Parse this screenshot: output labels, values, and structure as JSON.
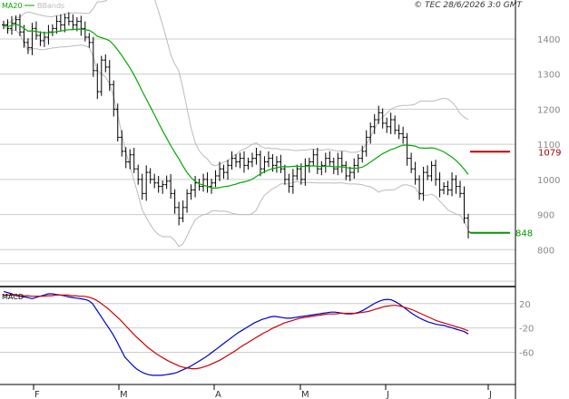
{
  "copyright": "© TEC 28/6/2026 3:0 GMT",
  "colors": {
    "ma": "#00aa00",
    "bbands": "#bbbbbb",
    "bars": "#000000",
    "macd": "#0000cc",
    "signal": "#cc0000",
    "resistance": "#cc0000",
    "support": "#009900",
    "grid": "#cccccc",
    "frame": "#000000"
  },
  "chart_data": [
    {
      "type": "ohlc",
      "legend": [
        {
          "label": "MA20",
          "color": "#00aa00"
        },
        {
          "label": "BBands",
          "color": "#bbbbbb"
        }
      ],
      "y_ticks": [
        800,
        900,
        1000,
        1100,
        1200,
        1300,
        1400
      ],
      "ylim": [
        700,
        1480
      ],
      "x_labels": [
        "F",
        "M",
        "A",
        "M",
        "J",
        "J"
      ],
      "levels": {
        "resistance": 1079,
        "support": 848
      },
      "level_labels": {
        "resistance": "1079",
        "support": "848"
      },
      "grid": true,
      "close": [
        1440,
        1430,
        1445,
        1455,
        1420,
        1390,
        1375,
        1430,
        1410,
        1395,
        1405,
        1420,
        1430,
        1450,
        1440,
        1460,
        1450,
        1440,
        1450,
        1430,
        1405,
        1390,
        1310,
        1250,
        1340,
        1320,
        1270,
        1200,
        1120,
        1080,
        1050,
        1070,
        1030,
        1000,
        960,
        1020,
        1000,
        990,
        980,
        985,
        995,
        960,
        920,
        890,
        920,
        960,
        970,
        990,
        980,
        1000,
        980,
        990,
        1010,
        1030,
        1020,
        1040,
        1060,
        1050,
        1060,
        1040,
        1050,
        1060,
        1070,
        1030,
        1050,
        1060,
        1040,
        1050,
        1030,
        1000,
        980,
        1010,
        1030,
        1000,
        1040,
        1050,
        1070,
        1030,
        1040,
        1060,
        1050,
        1030,
        1060,
        1040,
        1010,
        1020,
        1040,
        1060,
        1080,
        1120,
        1150,
        1170,
        1190,
        1160,
        1150,
        1170,
        1140,
        1130,
        1120,
        1060,
        1030,
        1000,
        960,
        1020,
        1010,
        1040,
        1000,
        970,
        980,
        970,
        1000,
        980,
        960,
        890,
        850
      ]
    },
    {
      "type": "line",
      "title": "MACD",
      "y_ticks": [
        20,
        -20,
        -60
      ],
      "y_tick_labels": [
        "20",
        "-20",
        "-60"
      ],
      "ylim": [
        -110,
        45
      ],
      "series": [
        {
          "color": "#0000cc",
          "values": [
            40,
            38,
            36,
            33,
            32,
            31,
            30,
            28,
            30,
            32,
            34,
            36,
            36,
            35,
            34,
            33,
            31,
            30,
            29,
            28,
            27,
            25,
            20,
            10,
            0,
            -10,
            -20,
            -30,
            -42,
            -55,
            -68,
            -75,
            -82,
            -88,
            -92,
            -95,
            -97,
            -98,
            -98,
            -98,
            -97,
            -96,
            -95,
            -93,
            -90,
            -87,
            -84,
            -80,
            -76,
            -72,
            -68,
            -63,
            -58,
            -53,
            -48,
            -43,
            -38,
            -33,
            -28,
            -24,
            -20,
            -16,
            -12,
            -9,
            -6,
            -4,
            -2,
            -1,
            -2,
            -3,
            -4,
            -4,
            -3,
            -2,
            -1,
            0,
            1,
            2,
            3,
            4,
            5,
            6,
            6,
            5,
            4,
            3,
            3,
            4,
            6,
            9,
            13,
            17,
            21,
            24,
            26,
            27,
            26,
            23,
            19,
            14,
            9,
            4,
            0,
            -4,
            -7,
            -10,
            -12,
            -14,
            -15,
            -16,
            -18,
            -20,
            -22,
            -24,
            -26,
            -30
          ]
        },
        {
          "color": "#cc0000",
          "values": [
            34,
            34,
            34,
            34,
            33,
            33,
            33,
            32,
            32,
            32,
            32,
            33,
            33,
            34,
            34,
            34,
            34,
            33,
            33,
            32,
            32,
            31,
            29,
            26,
            22,
            17,
            12,
            6,
            0,
            -6,
            -13,
            -20,
            -27,
            -34,
            -40,
            -46,
            -52,
            -57,
            -62,
            -66,
            -70,
            -74,
            -77,
            -80,
            -83,
            -85,
            -86,
            -87,
            -87,
            -86,
            -84,
            -82,
            -79,
            -76,
            -73,
            -69,
            -65,
            -61,
            -57,
            -52,
            -48,
            -44,
            -40,
            -36,
            -32,
            -28,
            -25,
            -21,
            -18,
            -15,
            -12,
            -10,
            -8,
            -6,
            -4,
            -3,
            -2,
            -1,
            0,
            1,
            2,
            3,
            3,
            3,
            4,
            4,
            4,
            4,
            4,
            5,
            6,
            7,
            9,
            11,
            13,
            15,
            16,
            17,
            17,
            16,
            14,
            12,
            10,
            7,
            4,
            1,
            -2,
            -5,
            -8,
            -10,
            -12,
            -14,
            -16,
            -18,
            -20,
            -22,
            -25
          ]
        }
      ]
    }
  ]
}
